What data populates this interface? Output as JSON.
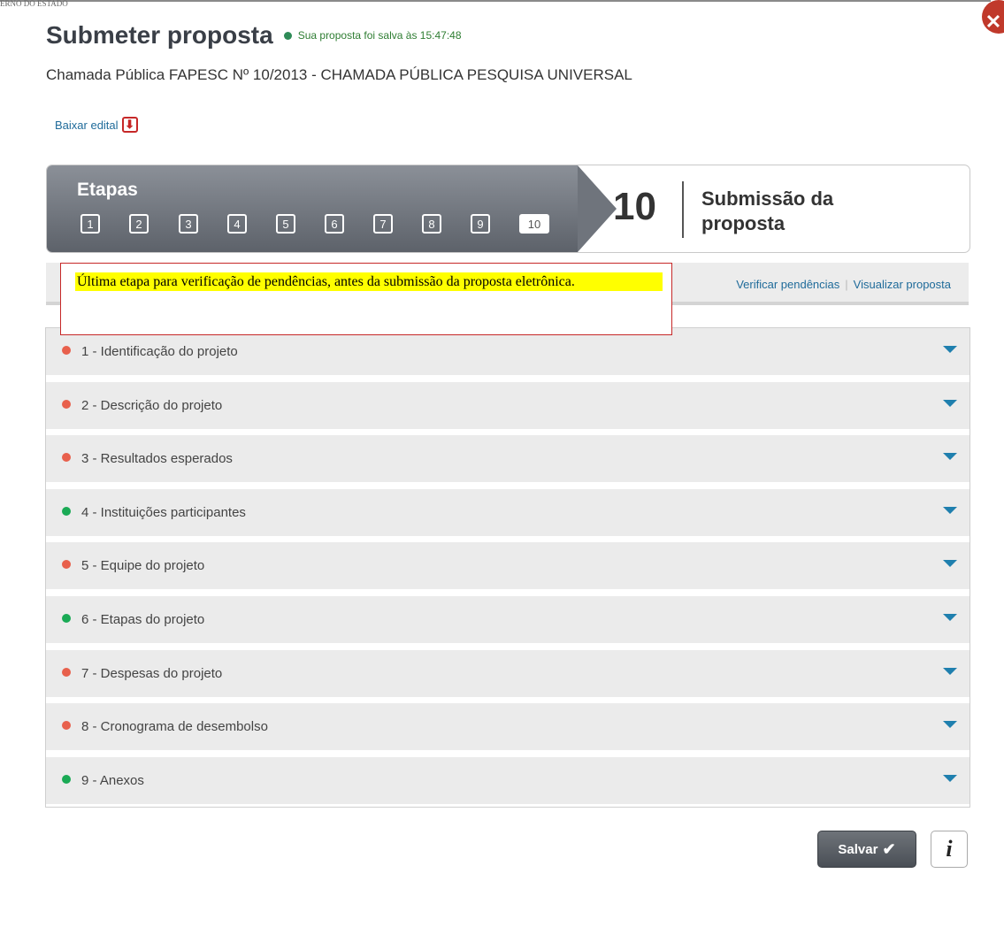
{
  "header": {
    "title": "Submeter proposta",
    "save_status": "Sua proposta foi salva às 15:47:48",
    "subtitle": "Chamada Pública FAPESC Nº 10/2013 - CHAMADA PÚBLICA PESQUISA UNIVERSAL",
    "download_label": "Baixar edital",
    "top_ghost_text": "ERNO DO ESTADO"
  },
  "steps": {
    "label": "Etapas",
    "items": [
      "1",
      "2",
      "3",
      "4",
      "5",
      "6",
      "7",
      "8",
      "9",
      "10"
    ],
    "active": "10",
    "current_number": "10",
    "current_title": "Submissão da proposta"
  },
  "toolbar": {
    "verify_label": "Verificar pendências",
    "preview_label": "Visualizar proposta"
  },
  "tooltip": {
    "text": "Última etapa para verificação de pendências, antes da submissão da proposta eletrônica."
  },
  "sections": [
    {
      "label": "1 - Identificação do projeto",
      "status": "red"
    },
    {
      "label": "2 - Descrição do projeto",
      "status": "red"
    },
    {
      "label": "3 - Resultados esperados",
      "status": "red"
    },
    {
      "label": "4 - Instituições participantes",
      "status": "green"
    },
    {
      "label": "5 - Equipe do projeto",
      "status": "red"
    },
    {
      "label": "6 - Etapas do projeto",
      "status": "green"
    },
    {
      "label": "7 - Despesas do projeto",
      "status": "red"
    },
    {
      "label": "8 - Cronograma de desembolso",
      "status": "red"
    },
    {
      "label": "9 - Anexos",
      "status": "green"
    }
  ],
  "colors": {
    "status_red": "#e8604c",
    "status_green": "#1aaa55",
    "accent": "#1f7fae"
  },
  "actions": {
    "save_label": "Salvar"
  }
}
